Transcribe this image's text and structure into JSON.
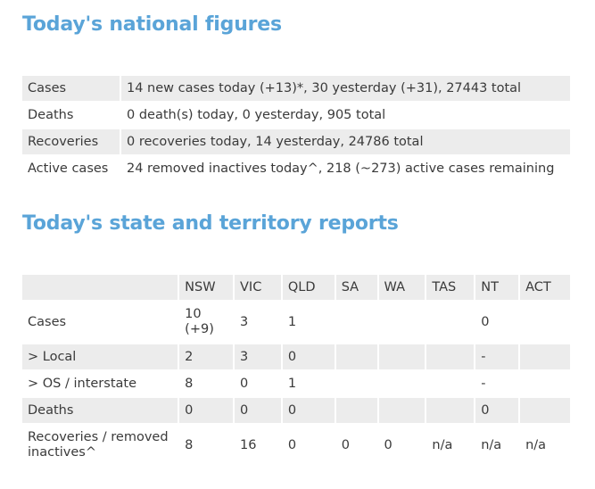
{
  "national": {
    "heading": "Today's national figures",
    "rows": [
      {
        "label": "Cases",
        "value": "14 new cases today (+13)*, 30 yesterday (+31), 27443 total"
      },
      {
        "label": "Deaths",
        "value": "0 death(s) today, 0 yesterday, 905 total"
      },
      {
        "label": "Recoveries",
        "value": "0 recoveries today, 14 yesterday, 24786 total"
      },
      {
        "label": "Active cases",
        "value": "24 removed inactives today^, 218 (~273) active cases remaining"
      }
    ]
  },
  "states": {
    "heading": "Today's state and territory reports",
    "columns": [
      "",
      "NSW",
      "VIC",
      "QLD",
      "SA",
      "WA",
      "TAS",
      "NT",
      "ACT"
    ],
    "rows": [
      {
        "label": "Cases",
        "cells": [
          "10\n(+9)",
          "3",
          "1",
          "",
          "",
          "",
          "0",
          ""
        ]
      },
      {
        "label": "> Local",
        "cells": [
          "2",
          "3",
          "0",
          "",
          "",
          "",
          "-",
          ""
        ]
      },
      {
        "label": "> OS / interstate",
        "cells": [
          "8",
          "0",
          "1",
          "",
          "",
          "",
          "-",
          ""
        ]
      },
      {
        "label": "Deaths",
        "cells": [
          "0",
          "0",
          "0",
          "",
          "",
          "",
          "0",
          ""
        ]
      },
      {
        "label": "Recoveries / removed inactives^",
        "cells": [
          "8",
          "16",
          "0",
          "0",
          "0",
          "n/a",
          "n/a",
          "n/a"
        ]
      }
    ]
  }
}
